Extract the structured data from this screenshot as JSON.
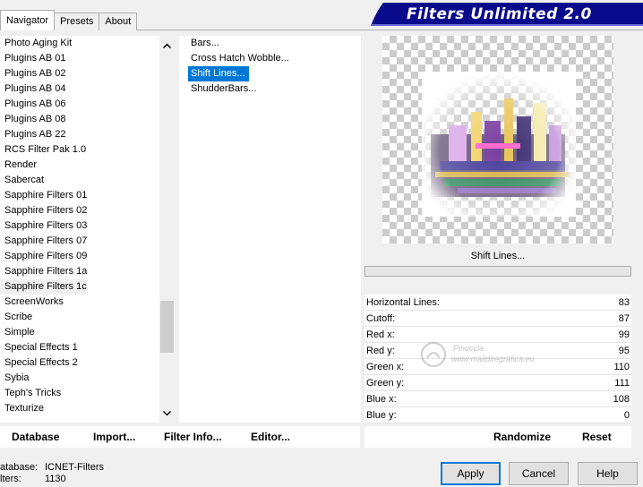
{
  "tabs": [
    "Navigator",
    "Presets",
    "About"
  ],
  "banner": {
    "title": "Filters Unlimited 2.0"
  },
  "categories": [
    "Photo Aging Kit",
    "Plugins AB 01",
    "Plugins AB 02",
    "Plugins AB 04",
    "Plugins AB 06",
    "Plugins AB 08",
    "Plugins AB 22",
    "RCS Filter Pak 1.0",
    "Render",
    "Sabercat",
    "Sapphire Filters 01",
    "Sapphire Filters 02",
    "Sapphire Filters 03",
    "Sapphire Filters 07",
    "Sapphire Filters 09",
    "Sapphire Filters 1a",
    "Sapphire Filters 1c",
    "ScreenWorks",
    "Scribe",
    "Simple",
    "Special Effects 1",
    "Special Effects 2",
    "Sybia",
    "Teph's Tricks",
    "Texturize"
  ],
  "selected_category": "Sapphire Filters 1c",
  "filters": [
    "Bars...",
    "Cross Hatch Wobble...",
    "Shift Lines...",
    "ShudderBars..."
  ],
  "selected_filter": "Shift Lines...",
  "preview": {
    "filter_name": "Shift Lines..."
  },
  "params": [
    {
      "label": "Horizontal Lines:",
      "value": "83"
    },
    {
      "label": "Cutoff:",
      "value": "87"
    },
    {
      "label": "Red x:",
      "value": "99"
    },
    {
      "label": "Red y:",
      "value": "95"
    },
    {
      "label": "Green x:",
      "value": "110"
    },
    {
      "label": "Green y:",
      "value": "111"
    },
    {
      "label": "Blue x:",
      "value": "108"
    },
    {
      "label": "Blue y:",
      "value": "0"
    }
  ],
  "watermark": {
    "line1": "Pinuccia",
    "line2": "www.maildiregrafica.eu"
  },
  "left_buttons": {
    "database": "Database",
    "import": "Import...",
    "filter_info": "Filter Info...",
    "editor": "Editor..."
  },
  "right_buttons": {
    "randomize": "Randomize",
    "reset": "Reset"
  },
  "status": {
    "database_key": "atabase:",
    "database_value": "ICNET-Filters",
    "filters_key": "lters:",
    "filters_value": "1130"
  },
  "dialog_buttons": {
    "apply": "Apply",
    "cancel": "Cancel",
    "help": "Help"
  },
  "icons": {
    "scroll_up": "chevron-up-icon",
    "scroll_down": "chevron-down-icon"
  },
  "colors": {
    "banner": "#0a0a8c",
    "selection": "#0078d7"
  }
}
